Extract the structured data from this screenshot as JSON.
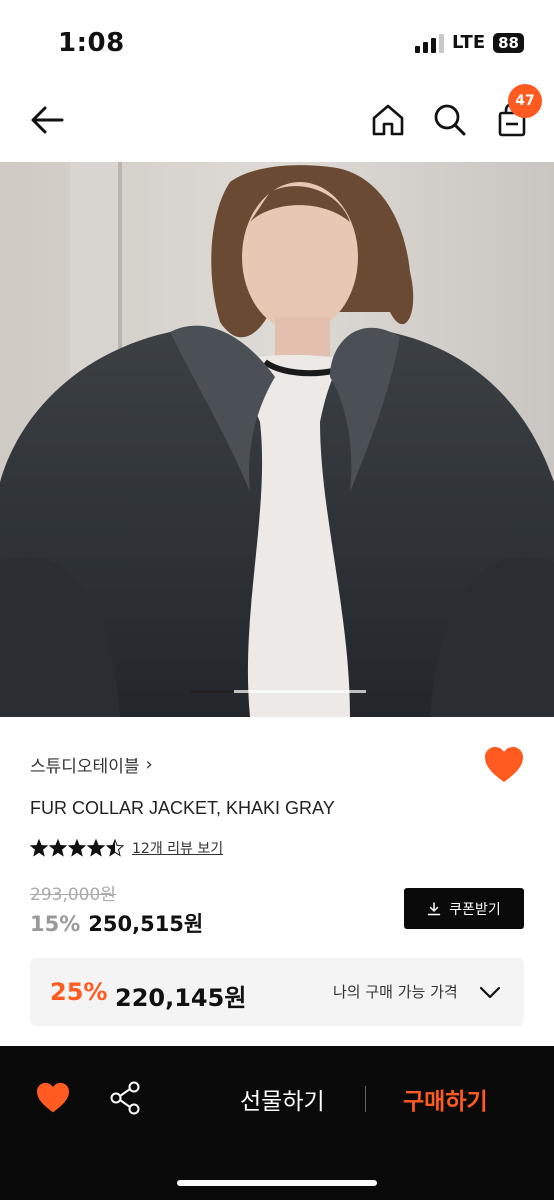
{
  "status_bar": {
    "time": "1:08",
    "network": "LTE",
    "battery": "88"
  },
  "nav": {
    "back_icon": "arrow-left-icon",
    "home_icon": "home-icon",
    "search_icon": "search-icon",
    "bag_icon": "shopping-bag-icon",
    "bag_badge_count": "47"
  },
  "product": {
    "image_indicator": {
      "current": 1,
      "total": 4
    },
    "brand": "스튜디오테이블",
    "brand_chevron": "›",
    "favorite": true,
    "title": "FUR COLLAR JACKET, KHAKI GRAY",
    "rating_stars": 4.5,
    "review_link": "12개 리뷰 보기",
    "original_price": "293,000원",
    "discount_percent": "15%",
    "sale_price": "250,515원",
    "coupon_button": "쿠폰받기"
  },
  "my_price": {
    "discount_percent": "25%",
    "price": "220,145원",
    "label": "나의 구매 가능 가격"
  },
  "bottom_bar": {
    "gift_label": "선물하기",
    "buy_label": "구매하기"
  },
  "colors": {
    "accent": "#ff5a1f",
    "dark": "#0a0a0a",
    "price_box_bg": "#f4f4f4"
  }
}
